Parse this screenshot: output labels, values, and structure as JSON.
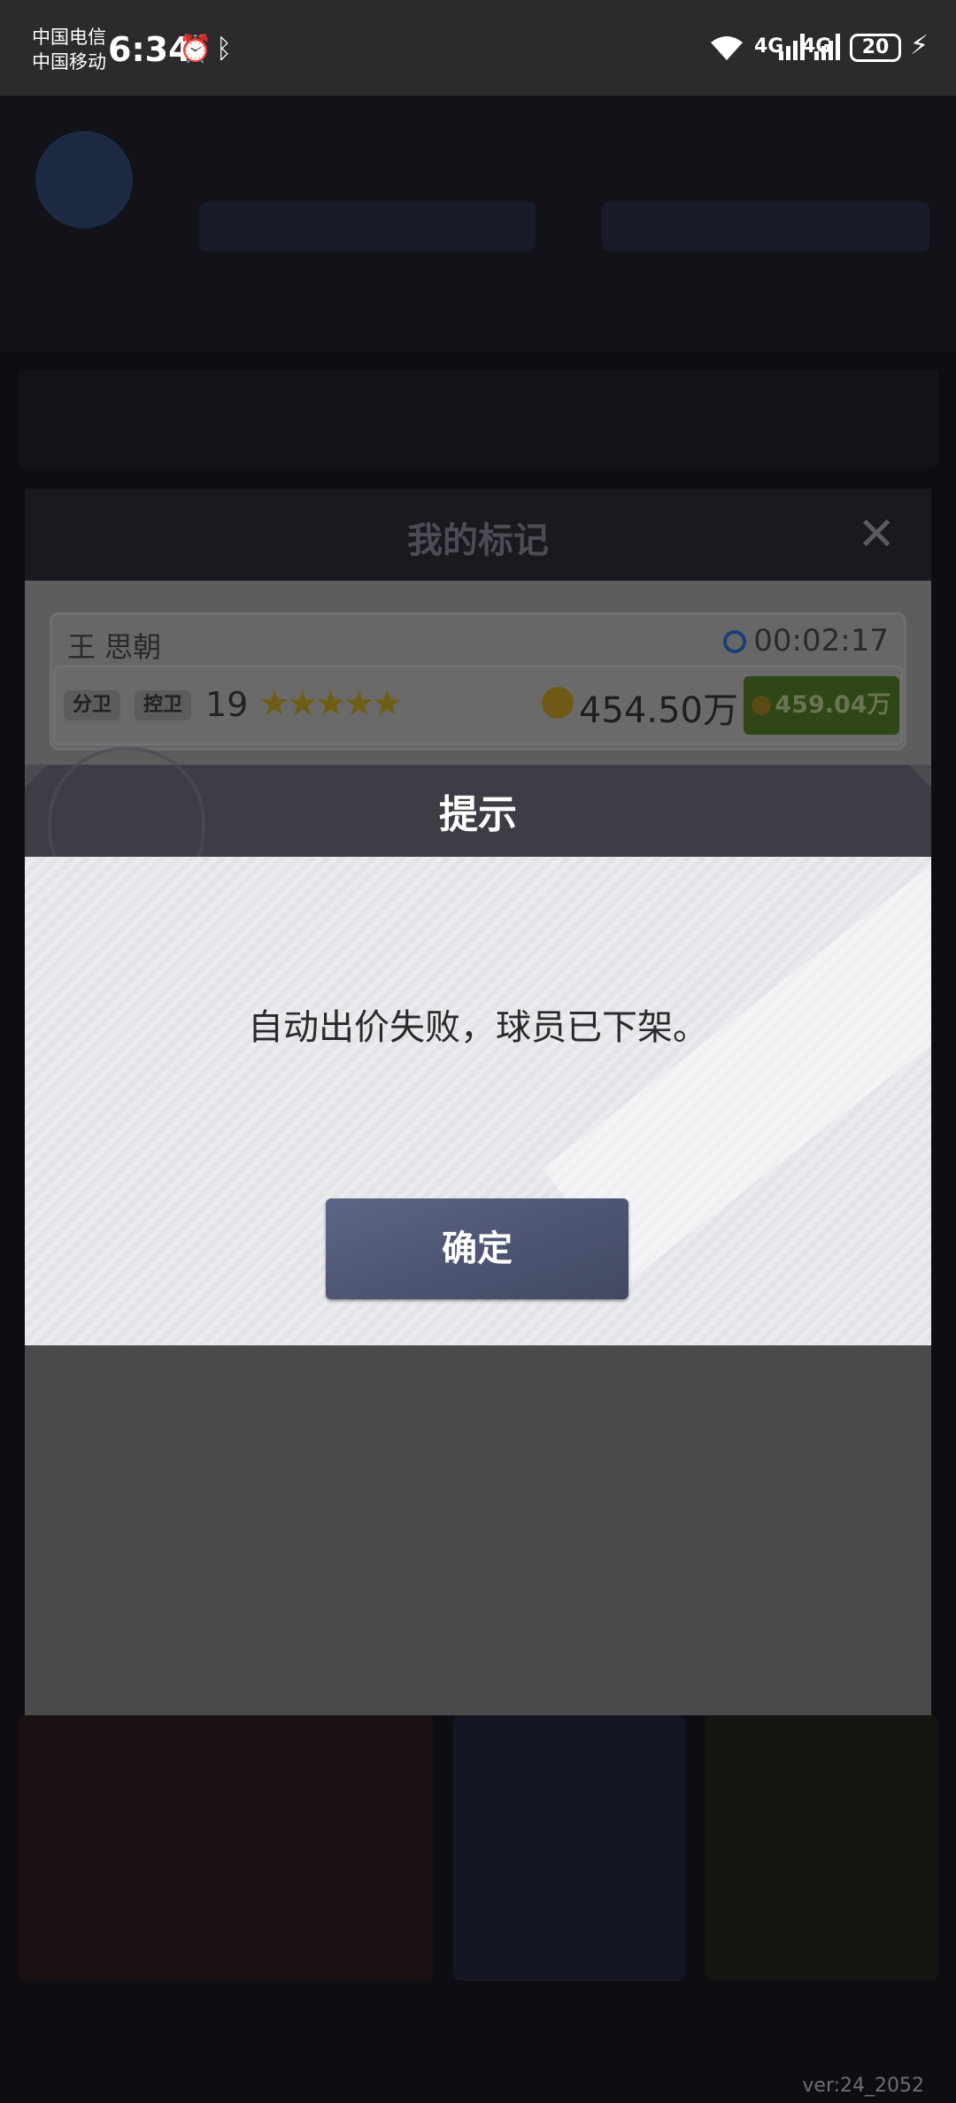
{
  "status_bar": {
    "carrier1": "中国电信",
    "carrier2": "中国移动",
    "time": "6:34",
    "battery": "20",
    "net1": "4G",
    "net2": "4G"
  },
  "marks_dialog": {
    "title": "我的标记",
    "player": {
      "name": "王 思朝",
      "timer": "00:02:17",
      "position1": "分卫",
      "position2": "控卫",
      "rating": "19",
      "stars": "★★★★★",
      "price": "454.50万",
      "buy_price": "459.04万"
    }
  },
  "alert": {
    "title": "提示",
    "message": "自动出价失败，球员已下架。",
    "confirm_label": "确定"
  },
  "footer": {
    "version": "ver:24_2052"
  },
  "colors": {
    "alert_header": "#3c3d45",
    "confirm_button": "#4d5472",
    "buy_button": "#2f4617"
  }
}
